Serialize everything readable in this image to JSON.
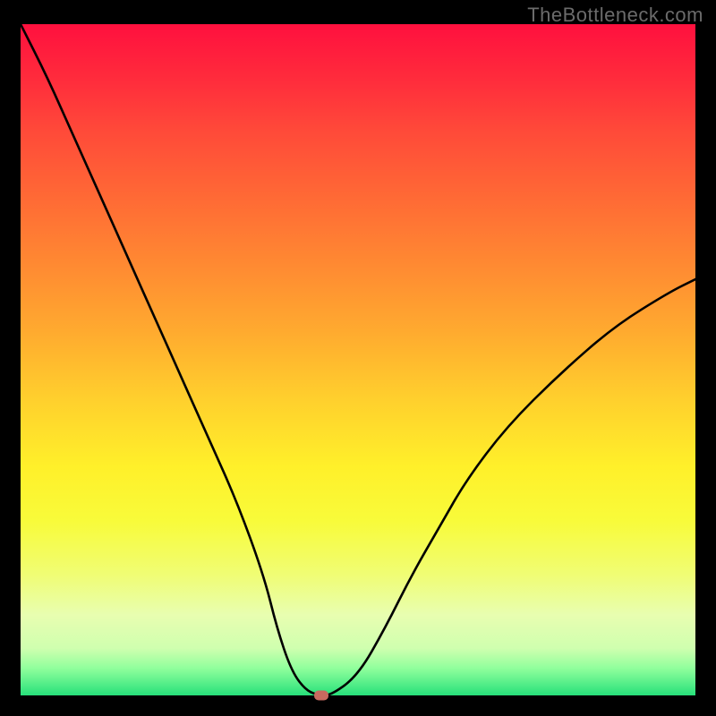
{
  "watermark": "TheBottleneck.com",
  "chart_data": {
    "type": "line",
    "title": "",
    "xlabel": "",
    "ylabel": "",
    "xlim": [
      0,
      100
    ],
    "ylim": [
      0,
      100
    ],
    "grid": false,
    "gradient": {
      "direction": "vertical",
      "stops": [
        {
          "pct": 0,
          "color": "#ff103e"
        },
        {
          "pct": 50,
          "color": "#ffc92c"
        },
        {
          "pct": 80,
          "color": "#f4fe50"
        },
        {
          "pct": 100,
          "color": "#27e07a"
        }
      ]
    },
    "series": [
      {
        "name": "bottleneck-curve",
        "x": [
          0,
          4,
          8,
          12,
          16,
          20,
          24,
          28,
          32,
          36,
          38,
          40,
          42,
          44,
          46,
          50,
          54,
          58,
          62,
          66,
          72,
          80,
          88,
          96,
          100
        ],
        "y": [
          100,
          92,
          83,
          74,
          65,
          56,
          47,
          38,
          29,
          18,
          10,
          4,
          1,
          0,
          0,
          3,
          10,
          18,
          25,
          32,
          40,
          48,
          55,
          60,
          62
        ]
      }
    ],
    "marker": {
      "x": 44.5,
      "y": 0,
      "shape": "pill",
      "color": "#c96a5f"
    }
  }
}
